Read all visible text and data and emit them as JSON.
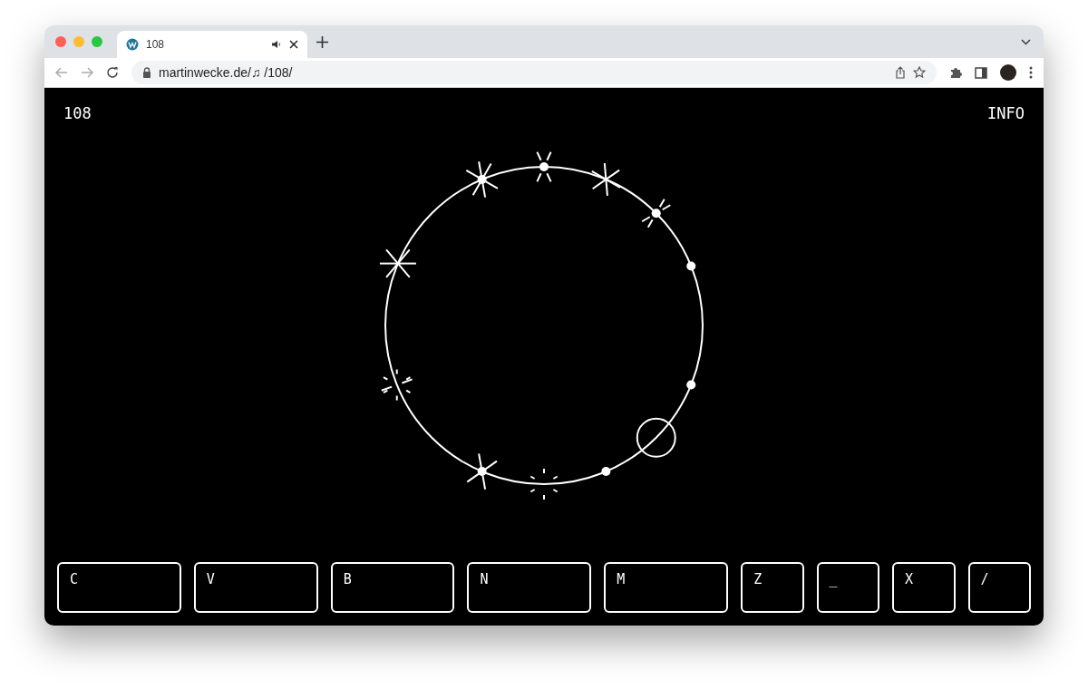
{
  "browser": {
    "tab": {
      "title": "108"
    },
    "url": "martinwecke.de/♫ /108/"
  },
  "header": {
    "title": "108",
    "info": "INFO"
  },
  "keys": [
    {
      "label": "C",
      "kind": "wide"
    },
    {
      "label": "V",
      "kind": "wide"
    },
    {
      "label": "B",
      "kind": "wide"
    },
    {
      "label": "N",
      "kind": "wide"
    },
    {
      "label": "M",
      "kind": "wide"
    },
    {
      "label": "Z",
      "kind": "narrow"
    },
    {
      "label": "_",
      "kind": "narrow"
    },
    {
      "label": "X",
      "kind": "narrow"
    },
    {
      "label": "/",
      "kind": "narrow"
    }
  ]
}
